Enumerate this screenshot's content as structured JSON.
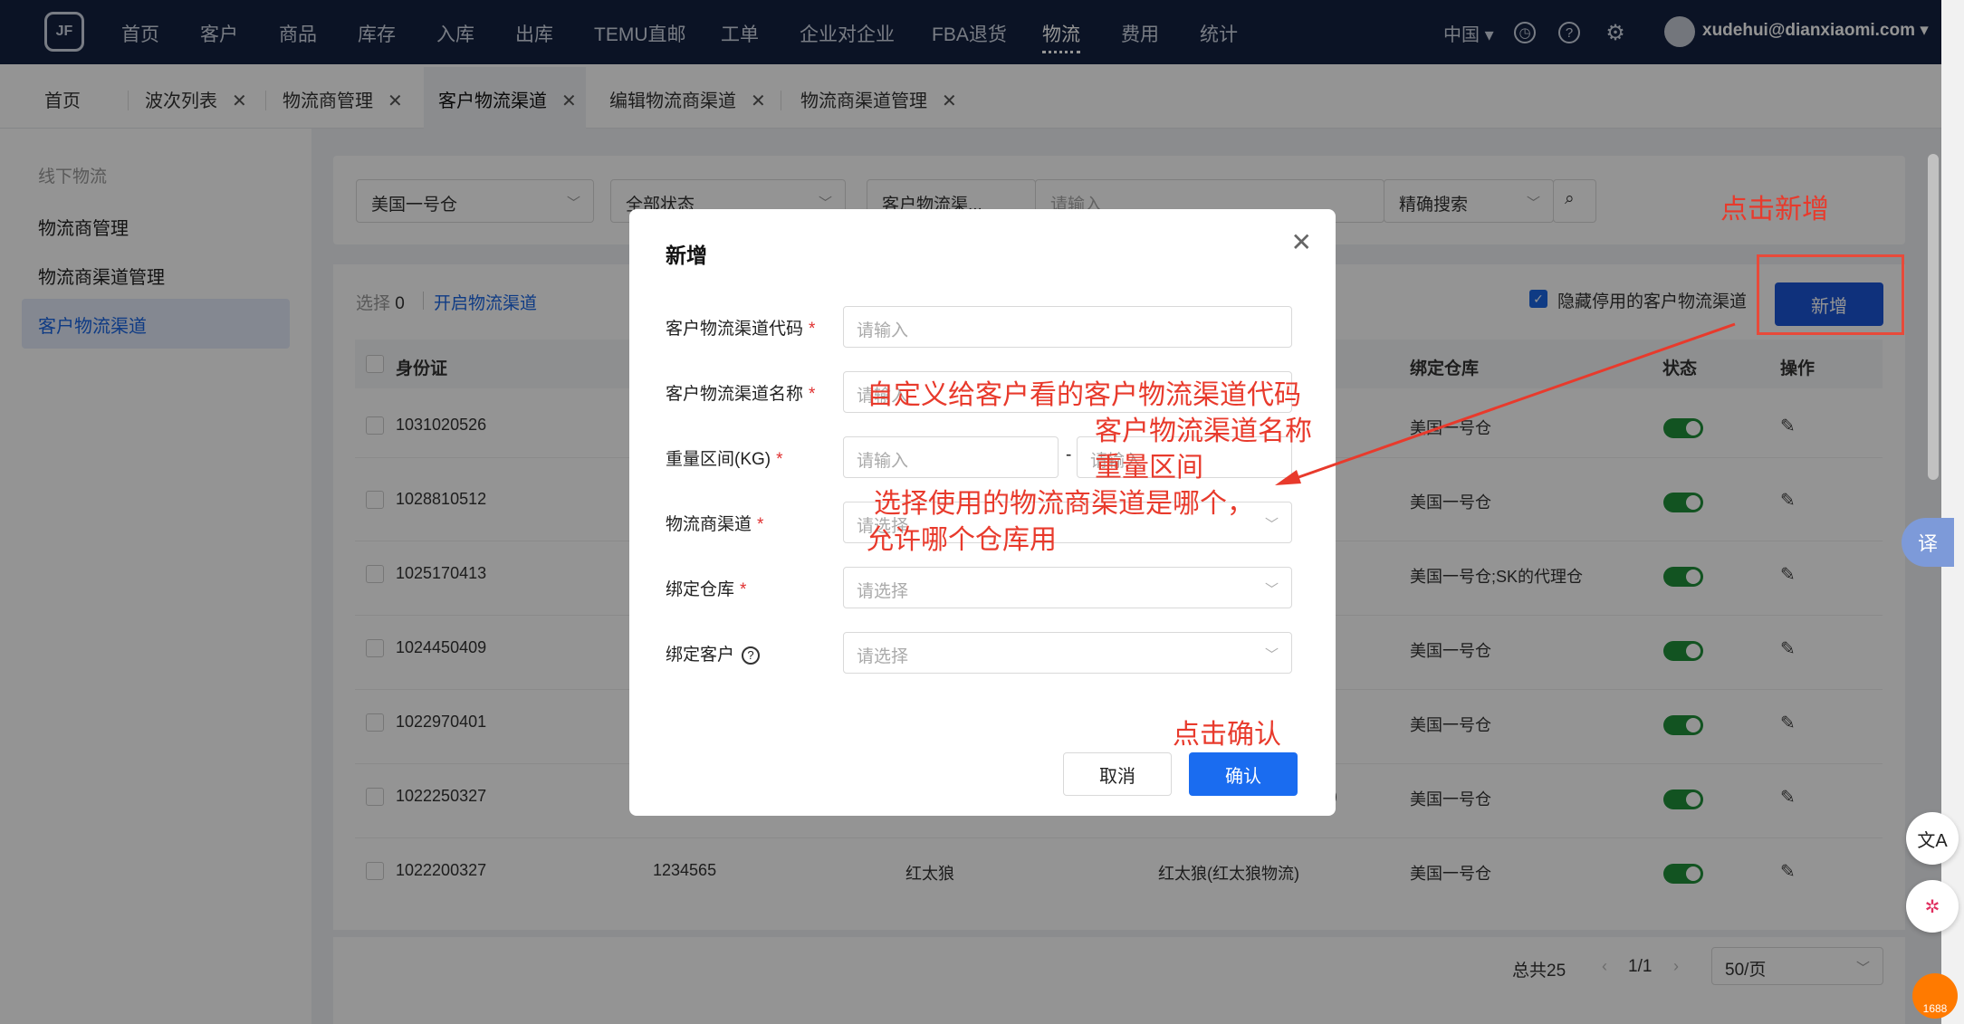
{
  "topnav": {
    "logo": "JF",
    "items": [
      "首页",
      "客户",
      "商品",
      "库存",
      "入库",
      "出库",
      "TEMU直邮",
      "工单",
      "企业对企业",
      "FBA退货",
      "物流",
      "费用",
      "统计"
    ],
    "active_index": 10,
    "language": "中国",
    "user_email": "xudehui@dianxiaomi.com"
  },
  "tabs": [
    {
      "label": "首页"
    },
    {
      "label": "波次列表"
    },
    {
      "label": "物流商管理"
    },
    {
      "label": "客户物流渠道"
    },
    {
      "label": "编辑物流商渠道"
    },
    {
      "label": "物流商渠道管理"
    }
  ],
  "sidebar": {
    "section": "线下物流",
    "items": [
      "物流商管理",
      "物流商渠道管理",
      "客户物流渠道"
    ],
    "active_index": 2
  },
  "filters": {
    "warehouse": "美国一号仓",
    "status": "全部状态",
    "field": "客户物流渠...",
    "search_placeholder": "请输入",
    "mode": "精确搜索"
  },
  "toolbar": {
    "selected_label": "选择",
    "selected_count": "0",
    "enable_link": "开启物流渠道",
    "hide_disabled_label": "隐藏停用的客户物流渠道",
    "add_button": "新增"
  },
  "table": {
    "headers": [
      "身份证",
      "",
      "",
      "",
      "绑定仓库",
      "状态",
      "操作"
    ],
    "rows": [
      {
        "id": "1031020526",
        "c2": "",
        "c3": "",
        "c4": "",
        "warehouse": "美国一号仓"
      },
      {
        "id": "1028810512",
        "c2": "",
        "c3": "",
        "c4": "",
        "warehouse": "美国一号仓"
      },
      {
        "id": "1025170413",
        "c2": "",
        "c3": "",
        "c4": "",
        "warehouse": "美国一号仓;SK的代理仓"
      },
      {
        "id": "1024450409",
        "c2": "",
        "c3": "",
        "c4": "",
        "warehouse": "美国一号仓"
      },
      {
        "id": "1022970401",
        "c2": "",
        "c3": "",
        "c4": "",
        "warehouse": "美国一号仓"
      },
      {
        "id": "1022250327",
        "c2": "",
        "c3": "",
        "c4": ")",
        "warehouse": "美国一号仓"
      },
      {
        "id": "1022200327",
        "c2": "1234565",
        "c3": "红太狼",
        "c4": "红太狼(红太狼物流)",
        "warehouse": "美国一号仓"
      }
    ]
  },
  "pagination": {
    "total": "总共25",
    "page": "1/1",
    "page_size": "50/页"
  },
  "modal": {
    "title": "新增",
    "fields": {
      "code_label": "客户物流渠道代码",
      "code_placeholder": "请输入",
      "name_label": "客户物流渠道名称",
      "name_placeholder": "请输入",
      "weight_label": "重量区间(KG)",
      "weight_min_placeholder": "请输入",
      "weight_separator": "-",
      "weight_max_placeholder": "请输入",
      "carrier_label": "物流商渠道",
      "carrier_placeholder": "请选择",
      "warehouse_label": "绑定仓库",
      "warehouse_placeholder": "请选择",
      "customer_label": "绑定客户",
      "customer_placeholder": "请选择"
    },
    "cancel": "取消",
    "confirm": "确认"
  },
  "annotations": {
    "click_add": "点击新增",
    "line1": "自定义给客户看的客户物流渠道代码",
    "line2": "客户物流渠道名称",
    "line3": "重量区间",
    "line4": "选择使用的物流商渠道是哪个，",
    "line5": "允许哪个仓库用",
    "click_confirm": "点击确认"
  },
  "float": {
    "translate": "译",
    "badge": "1688"
  },
  "colors": {
    "topbar": "#142240",
    "primary": "#1a66e3",
    "annotation": "#e83a2c",
    "switch_on": "#1f8f3a"
  }
}
